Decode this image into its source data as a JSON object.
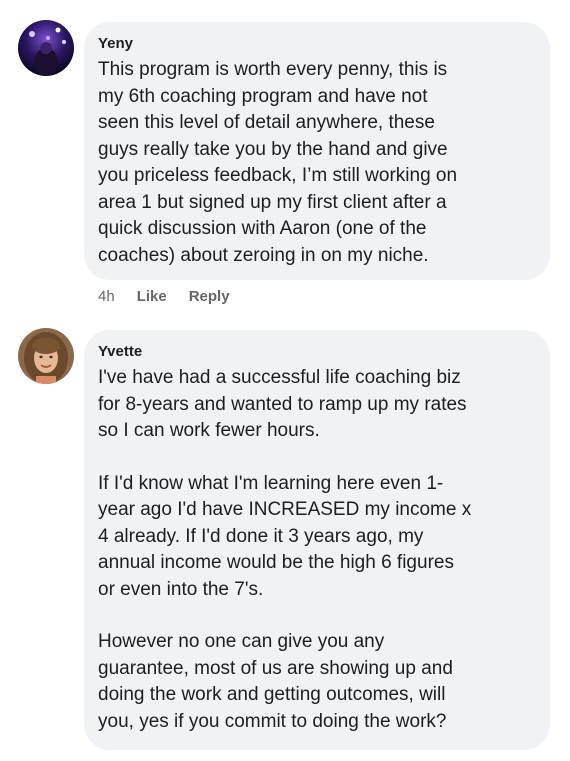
{
  "comments": [
    {
      "author": "Yeny",
      "lines": [
        "This program is worth every penny,  this is",
        "my 6th coaching program and have not",
        "seen this level of detail anywhere, these",
        "guys really take you by the hand and give",
        "you priceless feedback, I’m still working on",
        "area 1 but signed up my first client after a",
        "quick discussion with Aaron (one of the",
        "coaches) about zeroing in on my niche."
      ],
      "time": "4h",
      "like_label": "Like",
      "reply_label": "Reply"
    },
    {
      "author": "Yvette",
      "paragraphs": [
        {
          "lines": [
            "I've have had a successful life coaching biz",
            "for 8-years and wanted to ramp up my rates",
            "so I can work fewer hours."
          ]
        },
        {
          "lines": [
            "If I'd know what I'm learning here even 1-",
            "year ago I'd have INCREASED my income x",
            "4 already. If I'd done it 3 years ago, my",
            "annual income would be the high 6 figures",
            "or even into the 7's."
          ]
        },
        {
          "lines": [
            "However no one can give you any",
            "guarantee, most of us are showing up and",
            "doing the work and getting outcomes, will",
            "you, yes if you commit to doing the work?"
          ]
        }
      ]
    }
  ],
  "colors": {
    "bubble": "#f0f2f5",
    "text": "#1c1e21",
    "meta": "#65676b"
  },
  "icons": {
    "avatar_1": "avatar-concert-photo",
    "avatar_2": "avatar-woman-portrait"
  }
}
